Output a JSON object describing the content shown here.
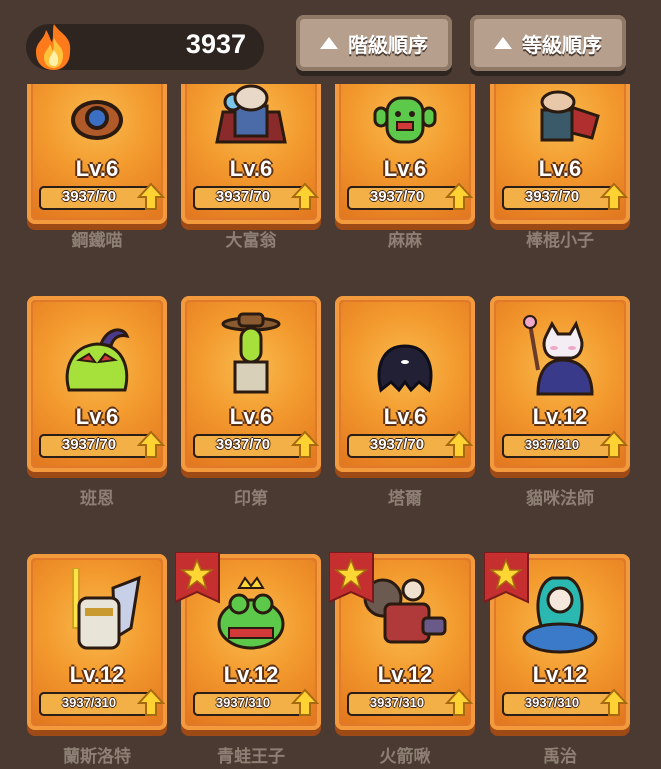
{
  "header": {
    "currency_icon": "flame-icon",
    "currency_value": "3937",
    "sort_rank_label": "階級順序",
    "sort_level_label": "等級順序"
  },
  "colors": {
    "background": "#4a3a31",
    "card_orange": "#e07a2a",
    "progress_fill": "#f3b046",
    "name_text": "#8d7f74",
    "star_flag": "#c52f2f",
    "up_arrow": "#ffd233"
  },
  "characters": [
    {
      "name": "鋼鐵喵",
      "level": "Lv.6",
      "progress": "3937/70",
      "starred": false
    },
    {
      "name": "大富翁",
      "level": "Lv.6",
      "progress": "3937/70",
      "starred": false
    },
    {
      "name": "麻麻",
      "level": "Lv.6",
      "progress": "3937/70",
      "starred": false
    },
    {
      "name": "棒棍小子",
      "level": "Lv.6",
      "progress": "3937/70",
      "starred": false
    },
    {
      "name": "班恩",
      "level": "Lv.6",
      "progress": "3937/70",
      "starred": false
    },
    {
      "name": "印第",
      "level": "Lv.6",
      "progress": "3937/70",
      "starred": false
    },
    {
      "name": "塔爾",
      "level": "Lv.6",
      "progress": "3937/70",
      "starred": false
    },
    {
      "name": "貓咪法師",
      "level": "Lv.12",
      "progress": "3937/310",
      "starred": false
    },
    {
      "name": "蘭斯洛特",
      "level": "Lv.12",
      "progress": "3937/310",
      "starred": false
    },
    {
      "name": "青蛙王子",
      "level": "Lv.12",
      "progress": "3937/310",
      "starred": true
    },
    {
      "name": "火箭啾",
      "level": "Lv.12",
      "progress": "3937/310",
      "starred": true
    },
    {
      "name": "禹治",
      "level": "Lv.12",
      "progress": "3937/310",
      "starred": true
    }
  ]
}
